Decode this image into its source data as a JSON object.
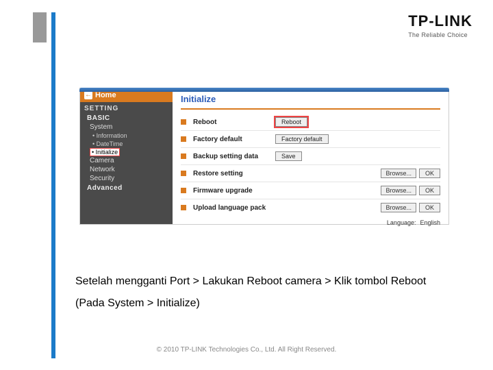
{
  "logo": {
    "brand": "TP-LINK",
    "tagline": "The Reliable Choice"
  },
  "sidebar": {
    "home": "Home",
    "section_setting": "SETTING",
    "section_basic": "BASIC",
    "sub_system": "System",
    "items": {
      "information": "• Information",
      "datetime": "• DateTime",
      "initialize": "• Initialize"
    },
    "camera": "Camera",
    "network": "Network",
    "security": "Security",
    "advanced": "Advanced"
  },
  "main": {
    "title": "Initialize",
    "rows": {
      "reboot": {
        "label": "Reboot",
        "button": "Reboot"
      },
      "factory": {
        "label": "Factory default",
        "button": "Factory default"
      },
      "backup": {
        "label": "Backup setting data",
        "button": "Save"
      },
      "restore": {
        "label": "Restore setting",
        "browse": "Browse...",
        "ok": "OK"
      },
      "firmware": {
        "label": "Firmware upgrade",
        "browse": "Browse...",
        "ok": "OK"
      },
      "langpack": {
        "label": "Upload language pack",
        "browse": "Browse...",
        "ok": "OK"
      },
      "language": {
        "label": "Language:",
        "value": "English"
      }
    }
  },
  "caption": {
    "line1": "Setelah mengganti Port > Lakukan Reboot camera > Klik tombol Reboot",
    "line2": "(Pada System > Initialize)"
  },
  "footer": "© 2010 TP-LINK Technologies Co., Ltd. All Right Reserved."
}
